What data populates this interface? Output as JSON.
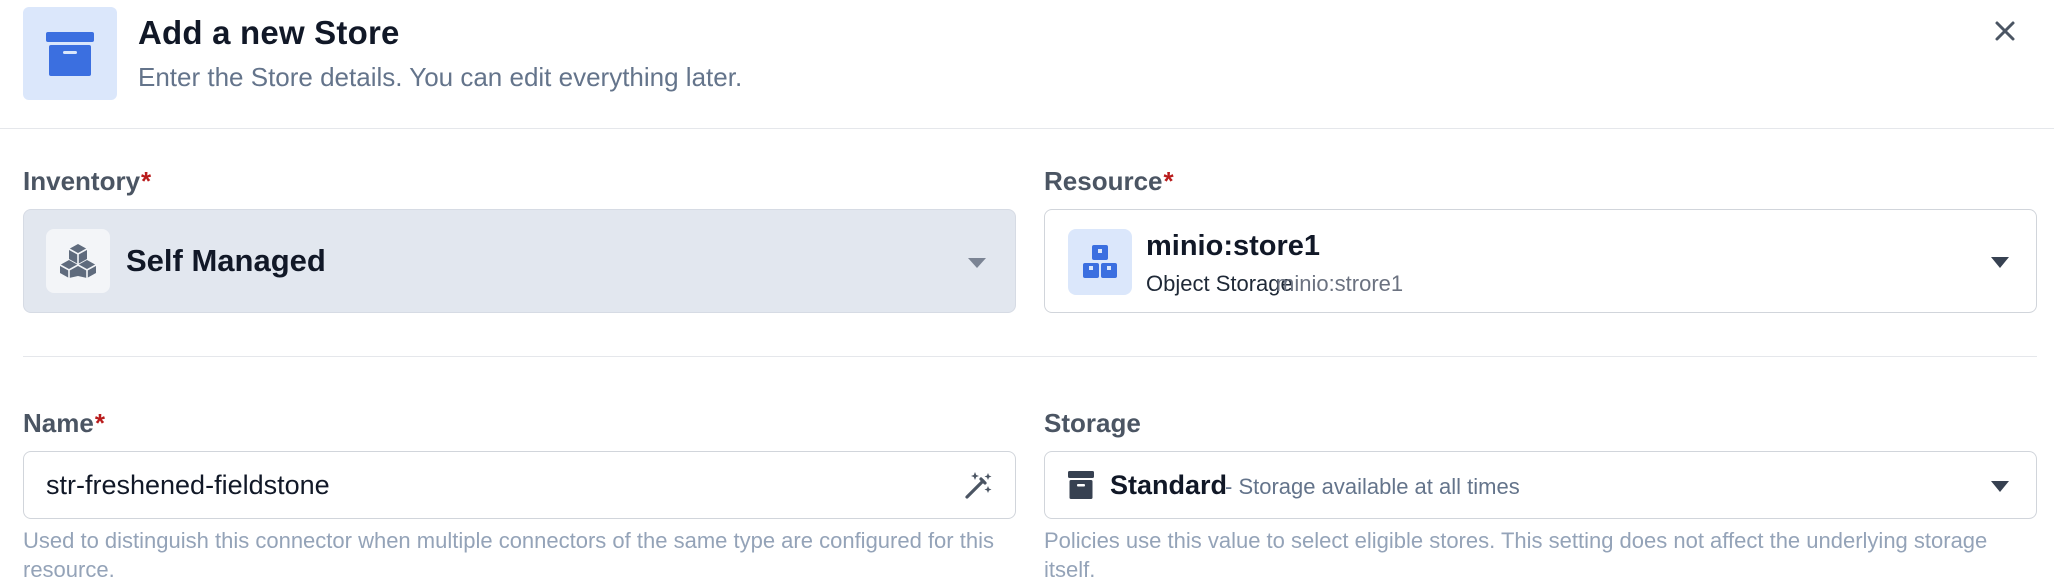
{
  "header": {
    "title": "Add a new Store",
    "subtitle": "Enter the Store details. You can edit everything later.",
    "icon": "archive-box-icon",
    "close_icon": "close-icon"
  },
  "inventory": {
    "label": "Inventory",
    "required_mark": "*",
    "value": "Self Managed",
    "icon": "cubes-icon"
  },
  "resource": {
    "label": "Resource",
    "required_mark": "*",
    "title": "minio:store1",
    "type": "Object Storage",
    "subtitle": "minio:strore1",
    "icon": "object-storage-icon"
  },
  "name": {
    "label": "Name",
    "required_mark": "*",
    "value": "str-freshened-fieldstone",
    "generate_icon": "magic-wand-icon",
    "help": "Used to distinguish this connector when multiple connectors of the same type are configured for this resource."
  },
  "storage": {
    "label": "Storage",
    "value": "Standard",
    "description": "- Storage available at all times",
    "icon": "archive-icon",
    "help": "Policies use this value to select eligible stores. This setting does not affect the underlying storage itself."
  },
  "colors": {
    "accent": "#3b6fe0",
    "accent_bg": "#dbe7fb",
    "required": "#b91c1c",
    "muted_text": "#64748b"
  }
}
